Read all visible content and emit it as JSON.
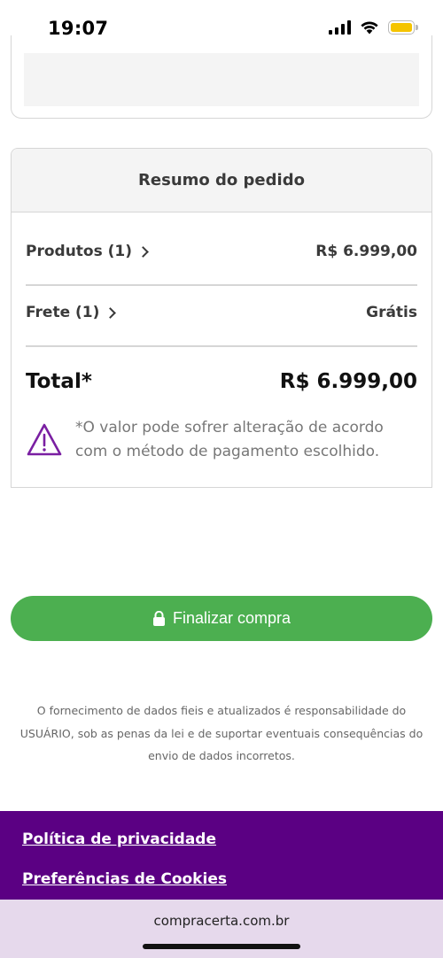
{
  "status_bar": {
    "time": "19:07"
  },
  "summary": {
    "title": "Resumo do pedido",
    "products_label": "Produtos (1)",
    "products_value": "R$ 6.999,00",
    "shipping_label": "Frete (1)",
    "shipping_value": "Grátis",
    "total_label": "Total*",
    "total_value": "R$ 6.999,00",
    "notice_text": "*O valor pode sofrer alteração de acordo com o método de pagamento escolhido."
  },
  "checkout": {
    "finalize_label": "Finalizar compra"
  },
  "disclaimer": "O fornecimento de dados fieis e atualizados é responsabilidade do USUÁRIO, sob as penas da lei e de suportar eventuais consequências do envio de dados incorretos.",
  "footer": {
    "privacy_link": "Política de privacidade",
    "cookies_link": "Preferências de Cookies"
  },
  "browser": {
    "url": "compracerta.com.br"
  },
  "colors": {
    "accent_green": "#4caf50",
    "footer_purple": "#5b0083",
    "warning_purple": "#7a1fa2",
    "battery_yellow": "#f5c400"
  },
  "icons": {
    "signal": "cellular-signal-icon",
    "wifi": "wifi-icon",
    "battery": "battery-icon",
    "warning": "warning-triangle-icon",
    "lock": "lock-icon",
    "chevron": "chevron-right-icon"
  }
}
